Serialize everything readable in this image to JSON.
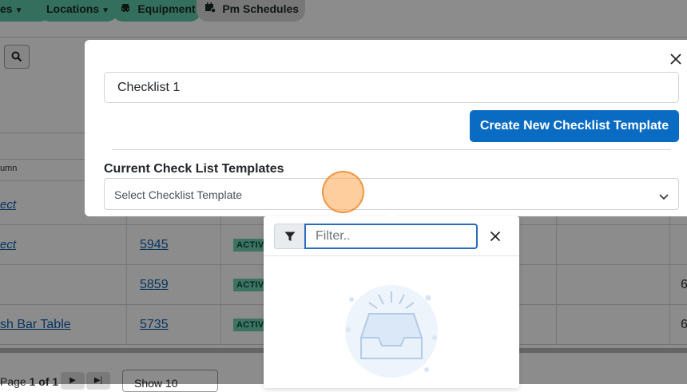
{
  "nav": {
    "items": [
      {
        "label": "es",
        "has_caret": true
      },
      {
        "label": "Locations",
        "has_caret": true
      },
      {
        "label": "Equipment",
        "icon": "car-icon"
      },
      {
        "label": "Pm Schedules",
        "icon": "calendar-gear-icon"
      }
    ]
  },
  "background_table": {
    "column_header": "umn",
    "rows": [
      {
        "name": "ect",
        "id": "",
        "status": ""
      },
      {
        "name": "ect",
        "id": "5945",
        "status": "ACTIV",
        "extra": ""
      },
      {
        "name": "",
        "id": "5859",
        "status": "ACTIV",
        "extra": "6"
      },
      {
        "name": "sh Bar Table",
        "id": "5735",
        "status": "ACTIV",
        "extra": "6"
      }
    ],
    "pager": {
      "prefix": "Page",
      "current": "1",
      "of": "of",
      "total": "1",
      "show_label": "Show 10"
    }
  },
  "modal": {
    "name_value": "Checklist 1",
    "create_button_label": "Create New Checklist Template",
    "section_label": "Current Check List Templates",
    "select_placeholder": "Select Checklist Template"
  },
  "dropdown": {
    "filter_placeholder": "Filter..",
    "filter_value": ""
  },
  "colors": {
    "primary": "#0a6bc2",
    "nav_green": "#5fc9a8",
    "badge_green": "#6fd1b3",
    "focus_border": "#2a6bbd",
    "link": "#0d5fb0"
  }
}
